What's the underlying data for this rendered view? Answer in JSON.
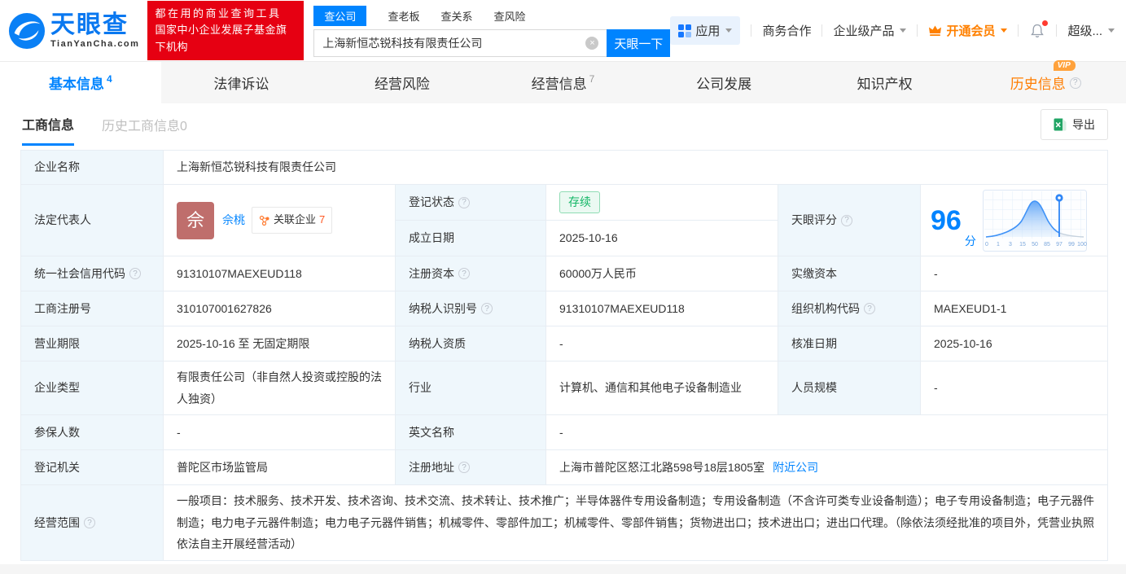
{
  "header": {
    "brand": {
      "name": "天眼查",
      "domain": "TianYanCha.com"
    },
    "slogan": {
      "line1": "都在用的商业查询工具",
      "line2": "国家中小企业发展子基金旗下机构"
    },
    "search": {
      "tabs": [
        {
          "label": "查公司"
        },
        {
          "label": "查老板"
        },
        {
          "label": "查关系"
        },
        {
          "label": "查风险"
        }
      ],
      "value": "上海新恒芯锐科技有限责任公司",
      "button": "天眼一下"
    },
    "nav": {
      "apps": "应用",
      "cooperation": "商务合作",
      "enterprise": "企业级产品",
      "vip": "开通会员",
      "user": "超级..."
    }
  },
  "tabs": [
    {
      "label": "基本信息",
      "count": "4"
    },
    {
      "label": "法律诉讼"
    },
    {
      "label": "经营风险"
    },
    {
      "label": "经营信息",
      "count": "7"
    },
    {
      "label": "公司发展"
    },
    {
      "label": "知识产权"
    },
    {
      "label": "历史信息"
    }
  ],
  "vip_badge": "VIP",
  "subtabs": [
    {
      "label": "工商信息"
    },
    {
      "label": "历史工商信息0"
    }
  ],
  "toolbar": {
    "export_label": "导出"
  },
  "info": {
    "name_label": "企业名称",
    "name": "上海新恒芯锐科技有限责任公司",
    "legal_rep_label": "法定代表人",
    "legal_rep_avatar": "佘",
    "legal_rep_name": "佘桃",
    "related_label": "关联企业",
    "related_count": "7",
    "reg_status_label": "登记状态",
    "reg_status": "存续",
    "est_date_label": "成立日期",
    "est_date": "2025-10-16",
    "score_label": "天眼评分",
    "score_value": "96",
    "score_unit": "分",
    "uscc_label": "统一社会信用代码",
    "uscc": "91310107MAEXEUD118",
    "reg_capital_label": "注册资本",
    "reg_capital": "60000万人民币",
    "paid_capital_label": "实缴资本",
    "paid_capital": "-",
    "reg_no_label": "工商注册号",
    "reg_no": "310107001627826",
    "taxpayer_id_label": "纳税人识别号",
    "taxpayer_id": "91310107MAEXEUD118",
    "org_code_label": "组织机构代码",
    "org_code": "MAEXEUD1-1",
    "biz_term_label": "营业期限",
    "biz_term": "2025-10-16 至 无固定期限",
    "taxpayer_qual_label": "纳税人资质",
    "taxpayer_qual": "-",
    "approval_date_label": "核准日期",
    "approval_date": "2025-10-16",
    "company_type_label": "企业类型",
    "company_type": "有限责任公司（非自然人投资或控股的法人独资）",
    "industry_label": "行业",
    "industry": "计算机、通信和其他电子设备制造业",
    "staff_size_label": "人员规模",
    "staff_size": "-",
    "insured_label": "参保人数",
    "insured": "-",
    "english_name_label": "英文名称",
    "english_name": "-",
    "reg_authority_label": "登记机关",
    "reg_authority": "普陀区市场监管局",
    "address_label": "注册地址",
    "address": "上海市普陀区怒江北路598号18层1805室",
    "nearby_link": "附近公司",
    "scope_label": "经营范围",
    "scope": "一般项目：技术服务、技术开发、技术咨询、技术交流、技术转让、技术推广；半导体器件专用设备制造；专用设备制造（不含许可类专业设备制造）；电子专用设备制造；电子元器件制造；电力电子元器件制造；电力电子元器件销售；机械零件、零部件加工；机械零件、零部件销售；货物进出口；技术进出口；进出口代理。（除依法须经批准的项目外，凭营业执照依法自主开展经营活动）"
  },
  "chart_data": {
    "type": "area",
    "title": "天眼评分",
    "score": 96,
    "x_ticks": [
      "0",
      "1",
      "3",
      "15",
      "50",
      "85",
      "97",
      "99",
      "100"
    ],
    "marker_tick": "97",
    "shape": "normal-distribution bell curve peaking near tick 50, marker pin at tick 97, tail after marker shown in gray",
    "grid": true,
    "xlabel": "",
    "ylabel": ""
  },
  "colors": {
    "brand_blue": "#0084ff",
    "promo_red": "#e60012",
    "vip_orange": "#ff8000",
    "status_green": "#12b665",
    "label_cell_bg": "#eff7fc",
    "avatar_bg": "#bf6e6c",
    "excel_green": "#21a565"
  }
}
